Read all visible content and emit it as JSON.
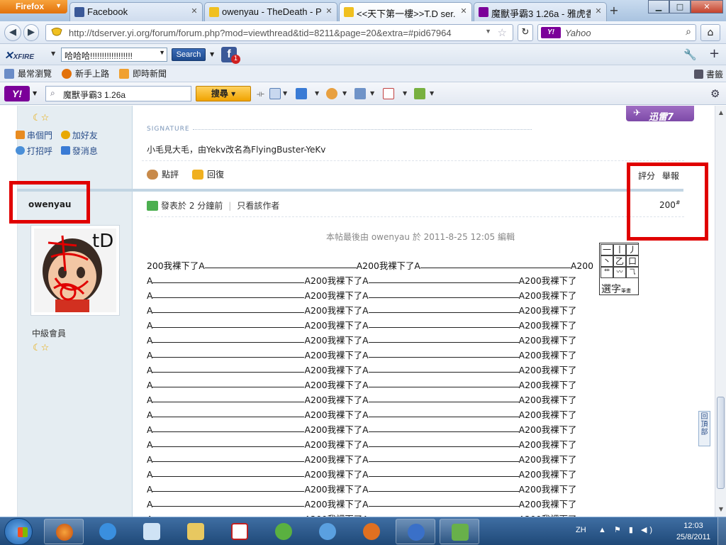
{
  "browser": {
    "menu_label": "Firefox",
    "tabs": [
      {
        "title": "Facebook",
        "icon": "facebook-icon",
        "color": "#3b5998"
      },
      {
        "title": "owenyau - TheDeath - P...",
        "icon": "forum-icon",
        "color": "#f0c020"
      },
      {
        "title": "<<天下第一樓>>T.D ser...",
        "icon": "forum-icon",
        "color": "#f0c020",
        "active": true
      },
      {
        "title": "魔獸爭霸3 1.26a - 雅虎香...",
        "icon": "yahoo-icon",
        "color": "#7b0099"
      }
    ],
    "new_tab": "+",
    "window_controls": {
      "minimize": "▁",
      "maximize": "□",
      "close": "✕"
    },
    "url": "http://tdserver.yi.org/forum/forum.php?mod=viewthread&tid=8211&page=20&extra=#pid67964",
    "search_engine": "Yahoo",
    "search_placeholder": "Yahoo",
    "bookmarks": [
      {
        "label": "最常瀏覽",
        "color": "#6a8cc7"
      },
      {
        "label": "新手上路",
        "color": "#e2710a"
      },
      {
        "label": "即時新聞",
        "color": "#f0a030"
      }
    ],
    "bookmarks_right": "書籤"
  },
  "xfire": {
    "logo": "XFIRE",
    "status_value": "哈哈哈!!!!!!!!!!!!!!!!!!",
    "search_label": "Search",
    "fb_badge": "1"
  },
  "yahoo_toolbar": {
    "query": "魔獸爭霸3 1.26a",
    "search_label": "搜尋"
  },
  "thunder": {
    "label": "迅雷7"
  },
  "post_prev": {
    "actions": [
      "串個門",
      "加好友",
      "打招呼",
      "發消息"
    ],
    "signature_label": "SIGNATURE",
    "signature_text": "小毛見大毛，由Yekv改名為FlyingBuster-YeKv",
    "buttons": [
      "點評",
      "回復"
    ],
    "rate_links": [
      "評分",
      "舉報"
    ]
  },
  "post": {
    "username": "owenyau",
    "rank": "中級會員",
    "posted": "發表於 2 分鐘前",
    "only_author": "只看該作者",
    "floor": "200",
    "floor_sup": "#",
    "edited_note": "本帖最後由 owenyau 於 2011-8-25 12:05 編輯",
    "first_line": [
      "200我裸下了A",
      "A200我裸下了A",
      "A200"
    ],
    "line_parts": [
      "A",
      "A200我裸下了A",
      "A200我裸下了"
    ],
    "line_count": 17
  },
  "ime": {
    "select_label": "選字",
    "select_sub": "筆畫"
  },
  "backtop": {
    "label": "回頂部"
  },
  "taskbar": {
    "lang": "ZH",
    "time": "12:03",
    "date": "25/8/2011"
  }
}
